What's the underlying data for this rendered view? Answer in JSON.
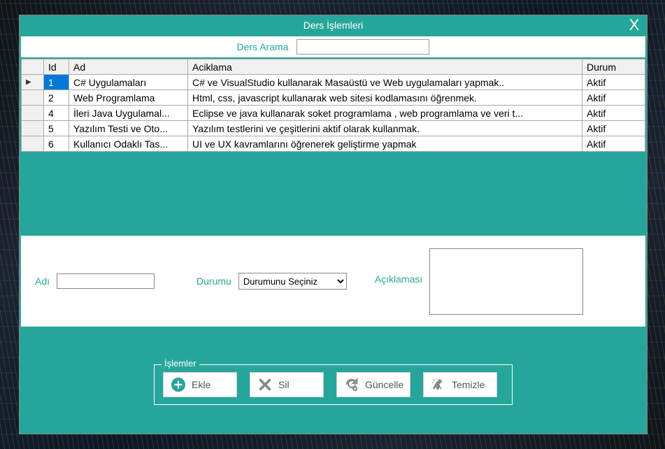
{
  "window": {
    "title": "Ders İşlemleri",
    "close": "X"
  },
  "search": {
    "label": "Ders Arama",
    "value": ""
  },
  "grid": {
    "headers": {
      "id": "Id",
      "ad": "Ad",
      "aciklama": "Aciklama",
      "durum": "Durum"
    },
    "rows": [
      {
        "id": "1",
        "ad": "C# Uygulamaları",
        "aciklama": "C# ve VisualStudio kullanarak Masaüstü ve Web uygulamaları yapmak..",
        "durum": "Aktif",
        "selected": true
      },
      {
        "id": "2",
        "ad": "Web Programlama",
        "aciklama": "Html, css, javascript kullanarak web sitesi kodlamasını öğrenmek.",
        "durum": "Aktif",
        "selected": false
      },
      {
        "id": "4",
        "ad": "İleri Java Uygulamal...",
        "aciklama": "Eclipse ve java kullanarak soket programlama , web programlama ve veri t...",
        "durum": "Aktif",
        "selected": false
      },
      {
        "id": "5",
        "ad": "Yazılım Testi ve Oto...",
        "aciklama": "Yazılım testlerini ve çeşitlerini aktif olarak kullanmak.",
        "durum": "Aktif",
        "selected": false
      },
      {
        "id": "6",
        "ad": "Kullanıcı Odaklı Tas...",
        "aciklama": "UI ve UX kavramlarını öğrenerek geliştirme yapmak",
        "durum": "Aktif",
        "selected": false
      }
    ]
  },
  "form": {
    "adi_label": "Adı",
    "adi_value": "",
    "durumu_label": "Durumu",
    "durumu_selected": "Durumunu Seçiniz",
    "aciklamasi_label": "Açıklaması",
    "aciklamasi_value": ""
  },
  "ops": {
    "legend": "İşlemler",
    "ekle": "Ekle",
    "sil": "Sil",
    "guncelle": "Güncelle",
    "temizle": "Temizle"
  },
  "colors": {
    "accent": "#26a69a",
    "selected": "#0078d7"
  }
}
